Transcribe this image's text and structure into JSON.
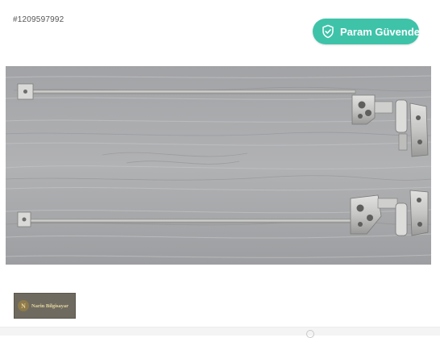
{
  "listing": {
    "id": "#1209597992"
  },
  "trust_badge": {
    "label": "Param Güvende",
    "icon": "shield-check-icon",
    "color": "#3ec3a9"
  },
  "product_image": {
    "alt": "Laptop menteşe"
  },
  "seller": {
    "name": "Narin Bilgisayar",
    "initial": "N"
  }
}
